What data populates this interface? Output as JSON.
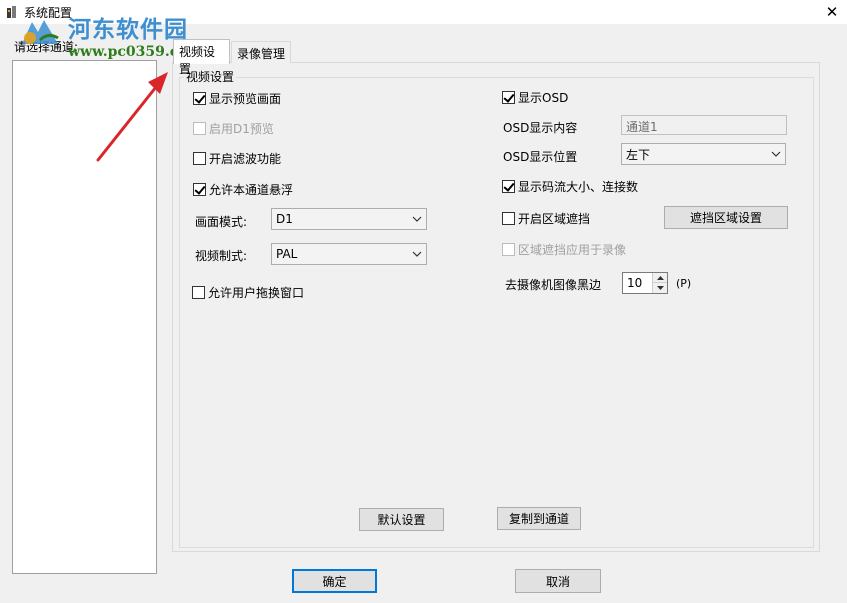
{
  "window": {
    "title": "系统配置",
    "close_glyph": "✕"
  },
  "watermark": {
    "title": "河东软件园",
    "url": "www.pc0359.cn"
  },
  "channel_panel": {
    "label": "请选择通道:",
    "items": []
  },
  "tabs": [
    {
      "label": "视频设置",
      "selected": true
    },
    {
      "label": "录像管理",
      "selected": false
    }
  ],
  "video_settings": {
    "group_title": "视频设置",
    "show_preview": {
      "label": "显示预览画面",
      "checked": true
    },
    "enable_d1_preview": {
      "label": "启用D1预览",
      "checked": false,
      "disabled": true
    },
    "enable_filter": {
      "label": "开启滤波功能",
      "checked": false
    },
    "allow_float": {
      "label": "允许本通道悬浮",
      "checked": true
    },
    "picture_mode": {
      "label": "画面模式:",
      "value": "D1"
    },
    "video_format": {
      "label": "视频制式:",
      "value": "PAL"
    },
    "allow_drag": {
      "label": "允许用户拖换窗口",
      "checked": false
    },
    "show_osd": {
      "label": "显示OSD",
      "checked": true
    },
    "osd_content": {
      "label": "OSD显示内容",
      "value": "通道1"
    },
    "osd_position": {
      "label": "OSD显示位置",
      "value": "左下"
    },
    "show_stream": {
      "label": "显示码流大小、连接数",
      "checked": true
    },
    "region_mask": {
      "label": "开启区域遮挡",
      "checked": false
    },
    "mask_settings_button": "遮挡区域设置",
    "mask_apply_record": {
      "label": "区域遮挡应用于录像",
      "checked": false,
      "disabled": true
    },
    "black_border": {
      "label": "去摄像机图像黑边",
      "value": "10",
      "unit": "(P)"
    },
    "default_button": "默认设置",
    "copy_button": "复制到通道"
  },
  "footer": {
    "ok_button": "确定",
    "cancel_button": "取消"
  },
  "colors": {
    "accent": "#0078d7",
    "annotation_arrow": "#d9262b",
    "watermark_blue": "#3d8fd1",
    "watermark_green": "#2d7d1c"
  }
}
